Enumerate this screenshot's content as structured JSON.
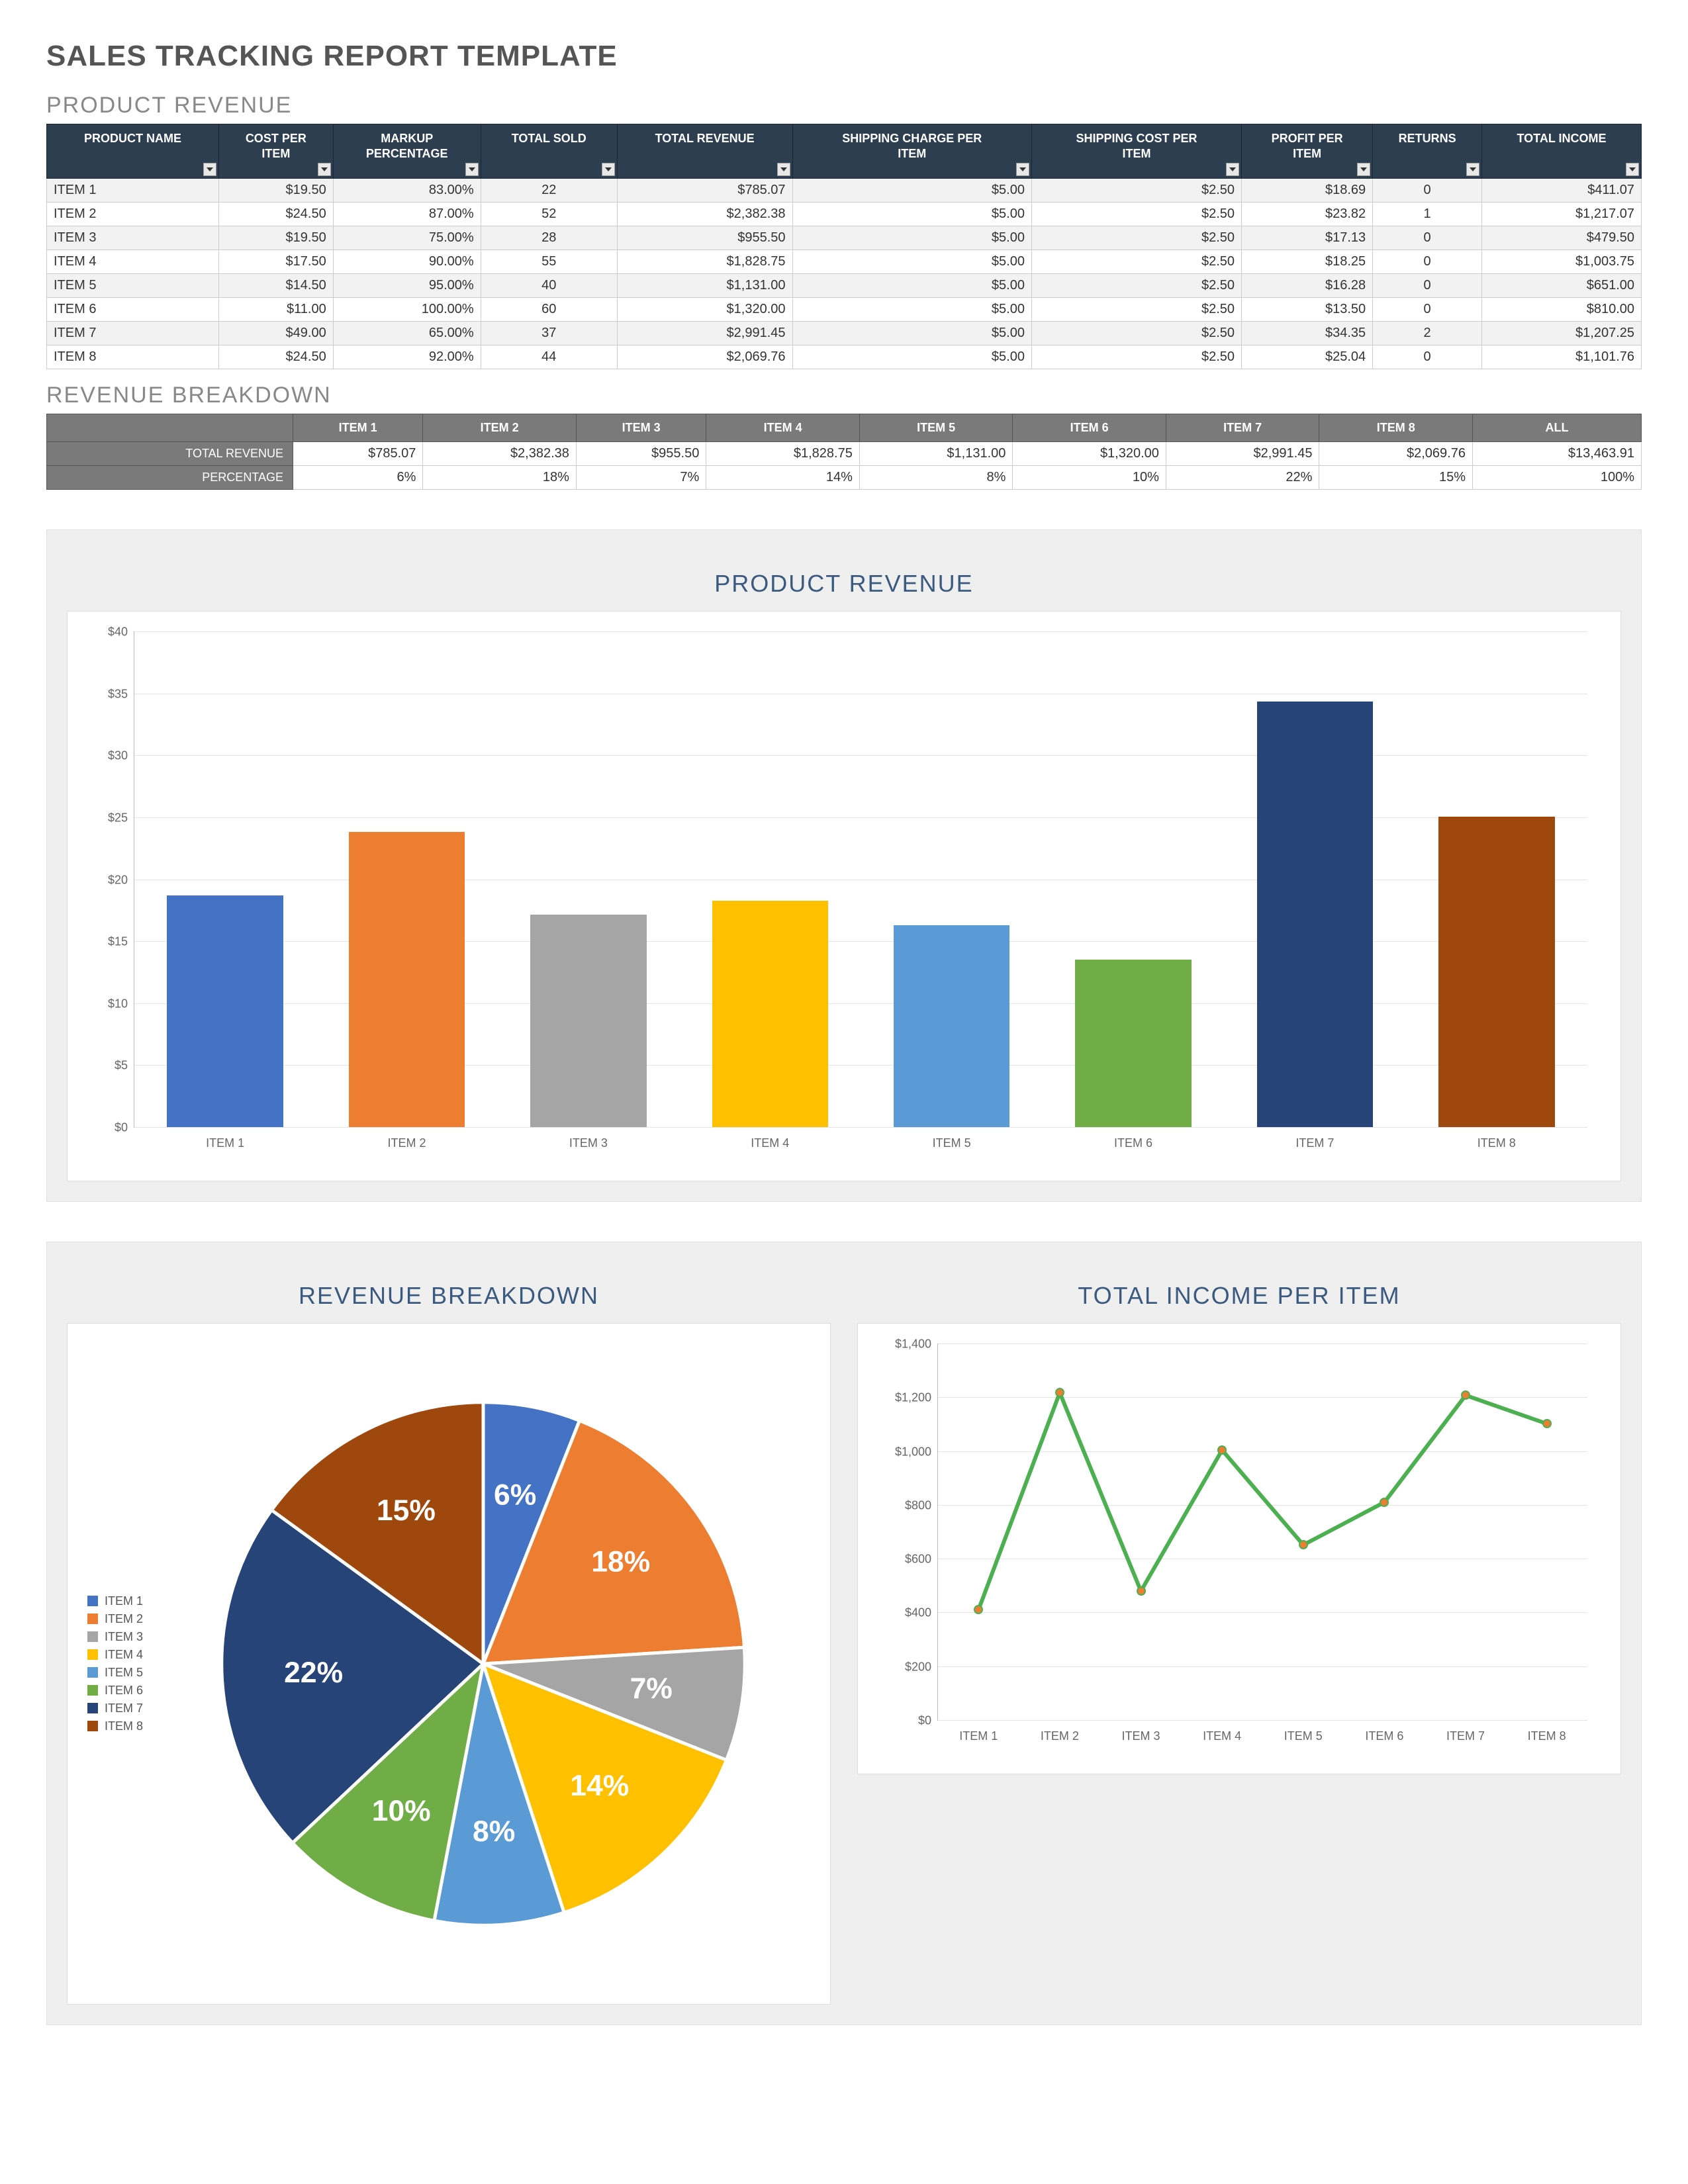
{
  "main_title": "SALES TRACKING REPORT TEMPLATE",
  "section_product_revenue": "PRODUCT REVENUE",
  "section_revenue_breakdown": "REVENUE BREAKDOWN",
  "chart1_title": "PRODUCT REVENUE",
  "chart2_title": "REVENUE BREAKDOWN",
  "chart3_title": "TOTAL INCOME PER ITEM",
  "product_table_headers": [
    "PRODUCT NAME",
    "COST PER ITEM",
    "MARKUP PERCENTAGE",
    "TOTAL SOLD",
    "TOTAL REVENUE",
    "SHIPPING CHARGE PER ITEM",
    "SHIPPING COST PER ITEM",
    "PROFIT PER ITEM",
    "RETURNS",
    "TOTAL INCOME"
  ],
  "product_rows": [
    {
      "name": "ITEM 1",
      "cost": "$19.50",
      "markup": "83.00%",
      "sold": "22",
      "revenue": "$785.07",
      "ship_charge": "$5.00",
      "ship_cost": "$2.50",
      "profit": "$18.69",
      "returns": "0",
      "income": "$411.07"
    },
    {
      "name": "ITEM 2",
      "cost": "$24.50",
      "markup": "87.00%",
      "sold": "52",
      "revenue": "$2,382.38",
      "ship_charge": "$5.00",
      "ship_cost": "$2.50",
      "profit": "$23.82",
      "returns": "1",
      "income": "$1,217.07"
    },
    {
      "name": "ITEM 3",
      "cost": "$19.50",
      "markup": "75.00%",
      "sold": "28",
      "revenue": "$955.50",
      "ship_charge": "$5.00",
      "ship_cost": "$2.50",
      "profit": "$17.13",
      "returns": "0",
      "income": "$479.50"
    },
    {
      "name": "ITEM 4",
      "cost": "$17.50",
      "markup": "90.00%",
      "sold": "55",
      "revenue": "$1,828.75",
      "ship_charge": "$5.00",
      "ship_cost": "$2.50",
      "profit": "$18.25",
      "returns": "0",
      "income": "$1,003.75"
    },
    {
      "name": "ITEM 5",
      "cost": "$14.50",
      "markup": "95.00%",
      "sold": "40",
      "revenue": "$1,131.00",
      "ship_charge": "$5.00",
      "ship_cost": "$2.50",
      "profit": "$16.28",
      "returns": "0",
      "income": "$651.00"
    },
    {
      "name": "ITEM 6",
      "cost": "$11.00",
      "markup": "100.00%",
      "sold": "60",
      "revenue": "$1,320.00",
      "ship_charge": "$5.00",
      "ship_cost": "$2.50",
      "profit": "$13.50",
      "returns": "0",
      "income": "$810.00"
    },
    {
      "name": "ITEM 7",
      "cost": "$49.00",
      "markup": "65.00%",
      "sold": "37",
      "revenue": "$2,991.45",
      "ship_charge": "$5.00",
      "ship_cost": "$2.50",
      "profit": "$34.35",
      "returns": "2",
      "income": "$1,207.25"
    },
    {
      "name": "ITEM 8",
      "cost": "$24.50",
      "markup": "92.00%",
      "sold": "44",
      "revenue": "$2,069.76",
      "ship_charge": "$5.00",
      "ship_cost": "$2.50",
      "profit": "$25.04",
      "returns": "0",
      "income": "$1,101.76"
    }
  ],
  "breakdown_col_headers": [
    "ITEM 1",
    "ITEM 2",
    "ITEM 3",
    "ITEM 4",
    "ITEM 5",
    "ITEM 6",
    "ITEM 7",
    "ITEM 8",
    "ALL"
  ],
  "breakdown_rows": [
    {
      "label": "TOTAL REVENUE",
      "vals": [
        "$785.07",
        "$2,382.38",
        "$955.50",
        "$1,828.75",
        "$1,131.00",
        "$1,320.00",
        "$2,991.45",
        "$2,069.76",
        "$13,463.91"
      ]
    },
    {
      "label": "PERCENTAGE",
      "vals": [
        "6%",
        "18%",
        "7%",
        "14%",
        "8%",
        "10%",
        "22%",
        "15%",
        "100%"
      ]
    }
  ],
  "colors": {
    "item1": "#4472c4",
    "item2": "#ed7d31",
    "item3": "#a5a5a5",
    "item4": "#ffc000",
    "item5": "#5b9bd5",
    "item6": "#70ad47",
    "item7": "#264478",
    "item8": "#9e480e",
    "line": "#4caf50"
  },
  "chart_data": [
    {
      "id": "bar",
      "type": "bar",
      "title": "PRODUCT REVENUE",
      "categories": [
        "ITEM 1",
        "ITEM 2",
        "ITEM 3",
        "ITEM 4",
        "ITEM 5",
        "ITEM 6",
        "ITEM 7",
        "ITEM 8"
      ],
      "values": [
        18.69,
        23.82,
        17.13,
        18.25,
        16.28,
        13.5,
        34.35,
        25.04
      ],
      "ylabel": "",
      "xlabel": "",
      "ylim": [
        0,
        40
      ],
      "ytick_labels": [
        "$0",
        "$5",
        "$10",
        "$15",
        "$20",
        "$25",
        "$30",
        "$35",
        "$40"
      ],
      "yticks": [
        0,
        5,
        10,
        15,
        20,
        25,
        30,
        35,
        40
      ],
      "series_colors": [
        "item1",
        "item2",
        "item3",
        "item4",
        "item5",
        "item6",
        "item7",
        "item8"
      ]
    },
    {
      "id": "pie",
      "type": "pie",
      "title": "REVENUE BREAKDOWN",
      "categories": [
        "ITEM 1",
        "ITEM 2",
        "ITEM 3",
        "ITEM 4",
        "ITEM 5",
        "ITEM 6",
        "ITEM 7",
        "ITEM 8"
      ],
      "values": [
        6,
        18,
        7,
        14,
        8,
        10,
        22,
        15
      ],
      "value_labels": [
        "6%",
        "18%",
        "7%",
        "14%",
        "8%",
        "10%",
        "22%",
        "15%"
      ],
      "series_colors": [
        "item1",
        "item2",
        "item3",
        "item4",
        "item5",
        "item6",
        "item7",
        "item8"
      ]
    },
    {
      "id": "line",
      "type": "line",
      "title": "TOTAL INCOME PER ITEM",
      "categories": [
        "ITEM 1",
        "ITEM 2",
        "ITEM 3",
        "ITEM 4",
        "ITEM 5",
        "ITEM 6",
        "ITEM 7",
        "ITEM 8"
      ],
      "values": [
        411.07,
        1217.07,
        479.5,
        1003.75,
        651.0,
        810.0,
        1207.25,
        1101.76
      ],
      "ylabel": "",
      "xlabel": "",
      "ylim": [
        0,
        1400
      ],
      "ytick_labels": [
        "$0",
        "$200",
        "$400",
        "$600",
        "$800",
        "$1,000",
        "$1,200",
        "$1,400"
      ],
      "yticks": [
        0,
        200,
        400,
        600,
        800,
        1000,
        1200,
        1400
      ],
      "line_color": "line",
      "marker_color": "item2"
    }
  ]
}
